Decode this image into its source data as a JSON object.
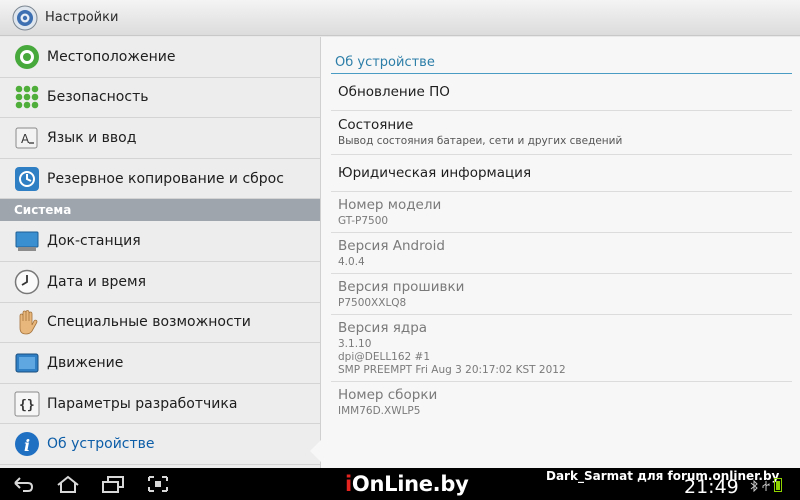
{
  "app": {
    "title": "Настройки"
  },
  "sidebar": {
    "items_top": [
      {
        "label": "Местоположение",
        "icon": "location-icon"
      },
      {
        "label": "Безопасность",
        "icon": "security-icon"
      },
      {
        "label": "Язык и ввод",
        "icon": "language-icon"
      },
      {
        "label": "Резервное копирование и сброс",
        "icon": "backup-icon"
      }
    ],
    "section": "Система",
    "items_bottom": [
      {
        "label": "Док-станция",
        "icon": "dock-icon"
      },
      {
        "label": "Дата и время",
        "icon": "clock-icon"
      },
      {
        "label": "Специальные возможности",
        "icon": "hand-icon"
      },
      {
        "label": "Движение",
        "icon": "motion-icon"
      },
      {
        "label": "Параметры разработчика",
        "icon": "braces-icon"
      },
      {
        "label": "Об устройстве",
        "icon": "info-icon"
      }
    ]
  },
  "details": {
    "header": "Об устройстве",
    "rows": [
      {
        "title": "Обновление ПО",
        "sub": ""
      },
      {
        "title": "Состояние",
        "sub": "Вывод состояния батареи, сети и других сведений"
      },
      {
        "title": "Юридическая информация",
        "sub": ""
      },
      {
        "title": "Номер модели",
        "sub": "GT-P7500"
      },
      {
        "title": "Версия Android",
        "sub": "4.0.4"
      },
      {
        "title": "Версия прошивки",
        "sub": "P7500XXLQ8"
      },
      {
        "title": "Версия ядра",
        "sub_lines": [
          "3.1.10",
          "dpi@DELL162 #1",
          "SMP PREEMPT Fri Aug 3 20:17:02 KST 2012"
        ]
      },
      {
        "title": "Номер сборки",
        "sub": "IMM76D.XWLP5"
      }
    ]
  },
  "navbar": {
    "watermark_logo_i": "i",
    "watermark_logo_rest": "OnLine.by",
    "watermark_text": "Dark_Sarmat для forum.onliner.by",
    "clock": "21:49"
  }
}
